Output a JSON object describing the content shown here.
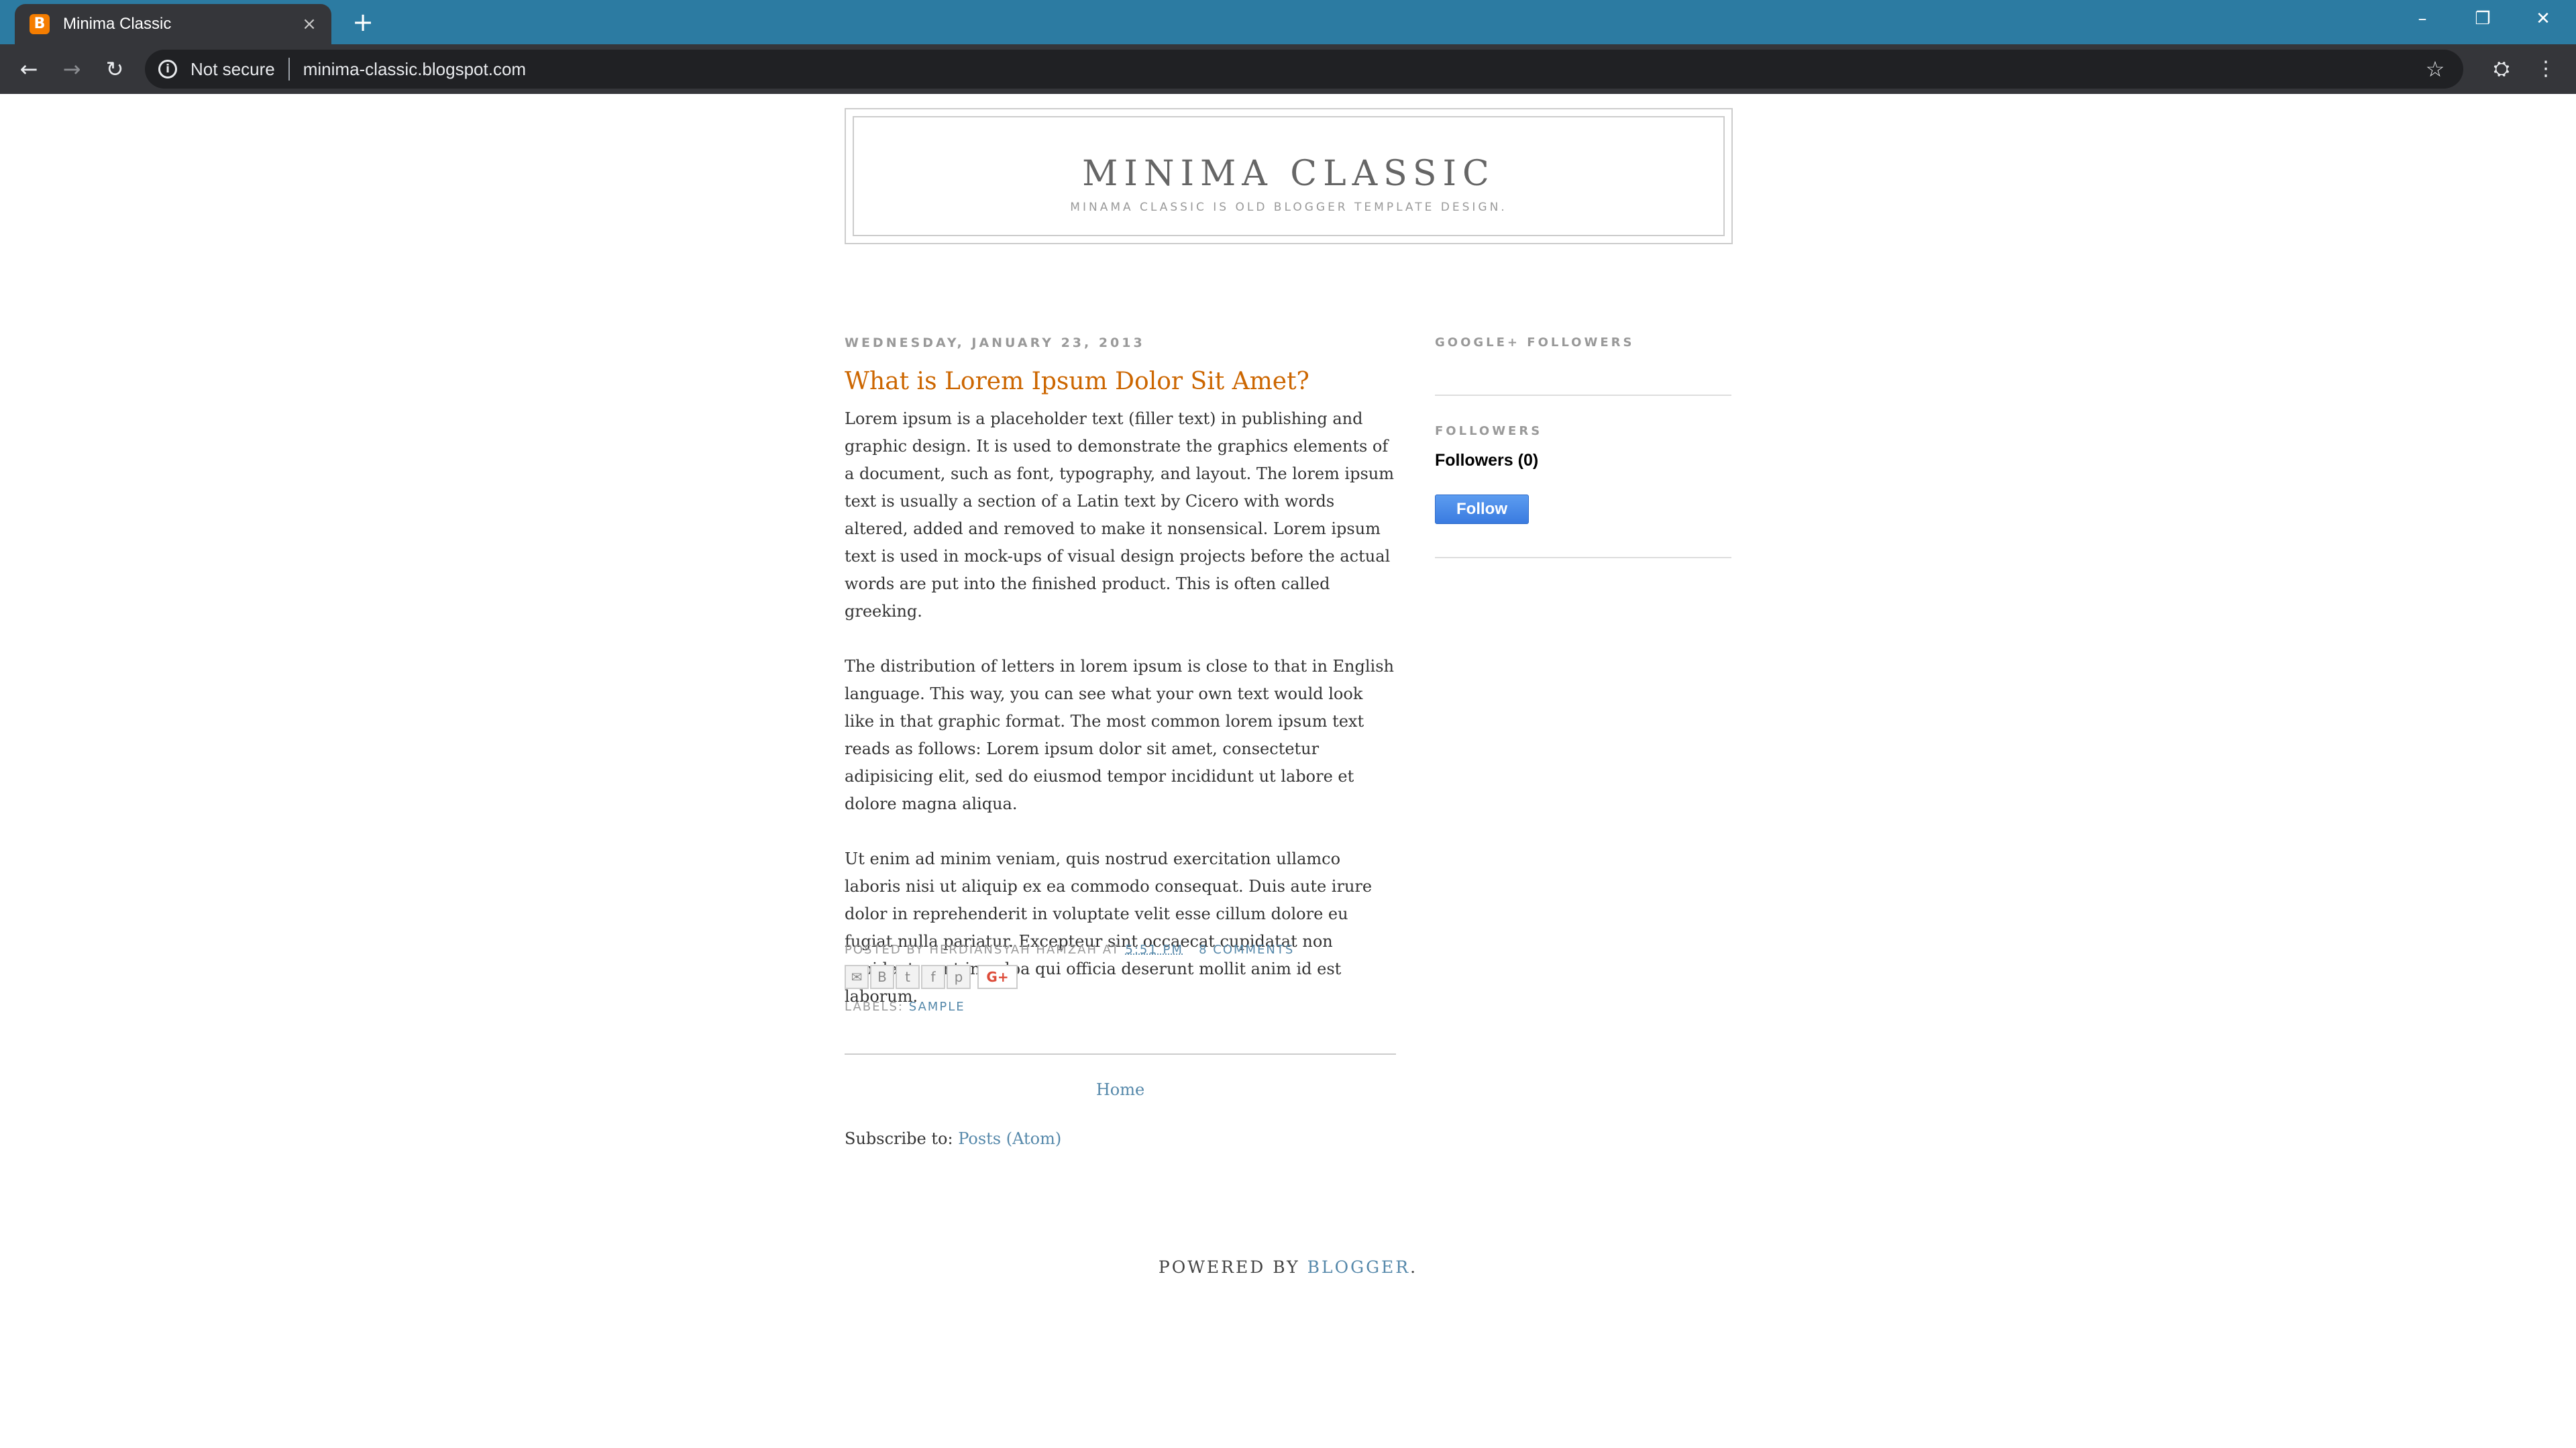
{
  "browser": {
    "tab_title": "Minima Classic",
    "tab_favicon": "B",
    "tab_close": "×",
    "new_tab": "+",
    "not_secure": "Not secure",
    "url": "minima-classic.blogspot.com",
    "colors": {
      "tabstrip": "#2c7ba2",
      "toolbar": "#35363a",
      "omnibox": "#202124"
    },
    "icons": [
      "back-icon",
      "forward-icon",
      "reload-icon",
      "info-icon",
      "star-icon",
      "incognito-icon",
      "menu-icon",
      "minimize-icon",
      "restore-icon",
      "close-icon"
    ]
  },
  "blog": {
    "title": "MINIMA CLASSIC",
    "description": "MINAMA CLASSIC IS OLD BLOGGER TEMPLATE DESIGN."
  },
  "post": {
    "date": "WEDNESDAY, JANUARY 23, 2013",
    "title": "What is Lorem Ipsum Dolor Sit Amet?",
    "paragraphs": [
      "Lorem ipsum is a placeholder text (filler text) in publishing and graphic design. It is used to demonstrate the graphics elements of a document, such as font, typography, and layout. The lorem ipsum text is usually a section of a Latin text by Cicero with words altered, added and removed to make it nonsensical. Lorem ipsum text is used in mock-ups of visual design projects before the actual words are put into the finished product. This is often called greeking.",
      "The distribution of letters in lorem ipsum is close to that in English language. This way, you can see what your own text would look like in that graphic format. The most common lorem ipsum text reads as follows: Lorem ipsum dolor sit amet, consectetur adipisicing elit, sed do eiusmod tempor incididunt ut labore et dolore magna aliqua.",
      "Ut enim ad minim veniam, quis nostrud exercitation ullamco laboris nisi ut aliquip ex ea commodo consequat. Duis aute irure dolor in reprehenderit in voluptate velit esse cillum dolore eu fugiat nulla pariatur. Excepteur sint occaecat cupidatat non proident, sunt in culpa qui officia deserunt mollit anim id est laborum."
    ],
    "footer": {
      "posted_by": "POSTED BY HERDIANSYAH HAMZAH AT",
      "time": "5:51 PM",
      "comments": "8 COMMENTS",
      "labels_prefix": "LABELS:",
      "label": "SAMPLE"
    },
    "share_icons": [
      "email-icon",
      "blogthis-icon",
      "twitter-icon",
      "facebook-icon",
      "pinterest-icon",
      "google-plus-icon"
    ],
    "gplus_label": "G+"
  },
  "nav": {
    "home": "Home",
    "subscribe_prefix": "Subscribe to:",
    "subscribe_link": "Posts (Atom)"
  },
  "sidebar": {
    "gplus_heading": "GOOGLE+ FOLLOWERS",
    "followers_heading": "FOLLOWERS",
    "followers_count": "Followers (0)",
    "follow_button": "Follow"
  },
  "footer": {
    "powered_prefix": "POWERED BY",
    "powered_link": "BLOGGER",
    "powered_suffix": "."
  },
  "colors": {
    "title": "#666666",
    "post_title": "#cc6600",
    "link": "#5588aa",
    "follow_button": "#3a7be0"
  }
}
